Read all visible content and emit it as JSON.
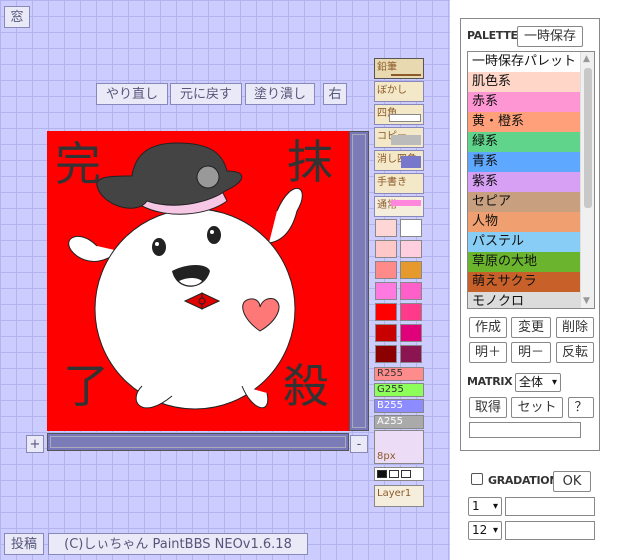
{
  "toolbar": {
    "window": "窓",
    "redo": "やり直し",
    "undo": "元に戻す",
    "fill": "塗り潰し",
    "right": "右"
  },
  "canvas": {
    "chars": [
      "完",
      "抹",
      "了",
      "殺"
    ],
    "zoom_in": "+",
    "zoom_out": "-"
  },
  "tools": [
    {
      "label": "鉛筆",
      "selected": true
    },
    {
      "label": "ぼかし",
      "selected": false
    },
    {
      "label": "四角",
      "selected": false
    },
    {
      "label": "コピー",
      "selected": false
    },
    {
      "label": "消し四角",
      "selected": false
    },
    {
      "label": "手書き",
      "selected": false
    },
    {
      "label": "通常",
      "selected": false
    }
  ],
  "swatches": {
    "left": [
      "#ffd6d6",
      "#ffc8c8",
      "#ff8a8a",
      "#ff7ae0",
      "#ff0000",
      "#c80000",
      "#8b0000"
    ],
    "right": [
      "#ffffff",
      "#ffcfe0",
      "#e69a2e",
      "#ff5fc8",
      "#ff3a8a",
      "#e0007a",
      "#8b1550"
    ]
  },
  "sliders": {
    "r": "R255",
    "g": "G255",
    "b": "B255",
    "a": "A255"
  },
  "brush_size": "8px",
  "layer": "Layer1",
  "bottom": {
    "post": "投稿",
    "credit": "(C)しぃちゃん PaintBBS NEOv1.6.18"
  },
  "palette": {
    "label": "PALETTE",
    "save_btn": "一時保存",
    "items": [
      {
        "name": "一時保存パレット",
        "color": "#ffffff"
      },
      {
        "name": "肌色系",
        "color": "#ffd6c8"
      },
      {
        "name": "赤系",
        "color": "#ff96d4"
      },
      {
        "name": "黄・橙系",
        "color": "#ffa07a"
      },
      {
        "name": "緑系",
        "color": "#5fd48a"
      },
      {
        "name": "青系",
        "color": "#5fa8ff"
      },
      {
        "name": "紫系",
        "color": "#d7a0f5"
      },
      {
        "name": "セピア",
        "color": "#c8a080"
      },
      {
        "name": "人物",
        "color": "#f0a070"
      },
      {
        "name": "パステル",
        "color": "#87cdf5"
      },
      {
        "name": "草原の大地",
        "color": "#6ab42e"
      },
      {
        "name": "萌えサクラ",
        "color": "#c8602a"
      },
      {
        "name": "モノクロ",
        "color": "#dcdcdc"
      }
    ],
    "create": "作成",
    "change": "変更",
    "delete": "削除",
    "lighter": "明＋",
    "darker": "明－",
    "invert": "反転"
  },
  "matrix": {
    "label": "MATRIX",
    "select": "全体",
    "get": "取得",
    "set": "セット",
    "help": "？"
  },
  "gradation": {
    "label": "GRADATION",
    "ok": "OK",
    "select1": "1",
    "select2": "12"
  }
}
